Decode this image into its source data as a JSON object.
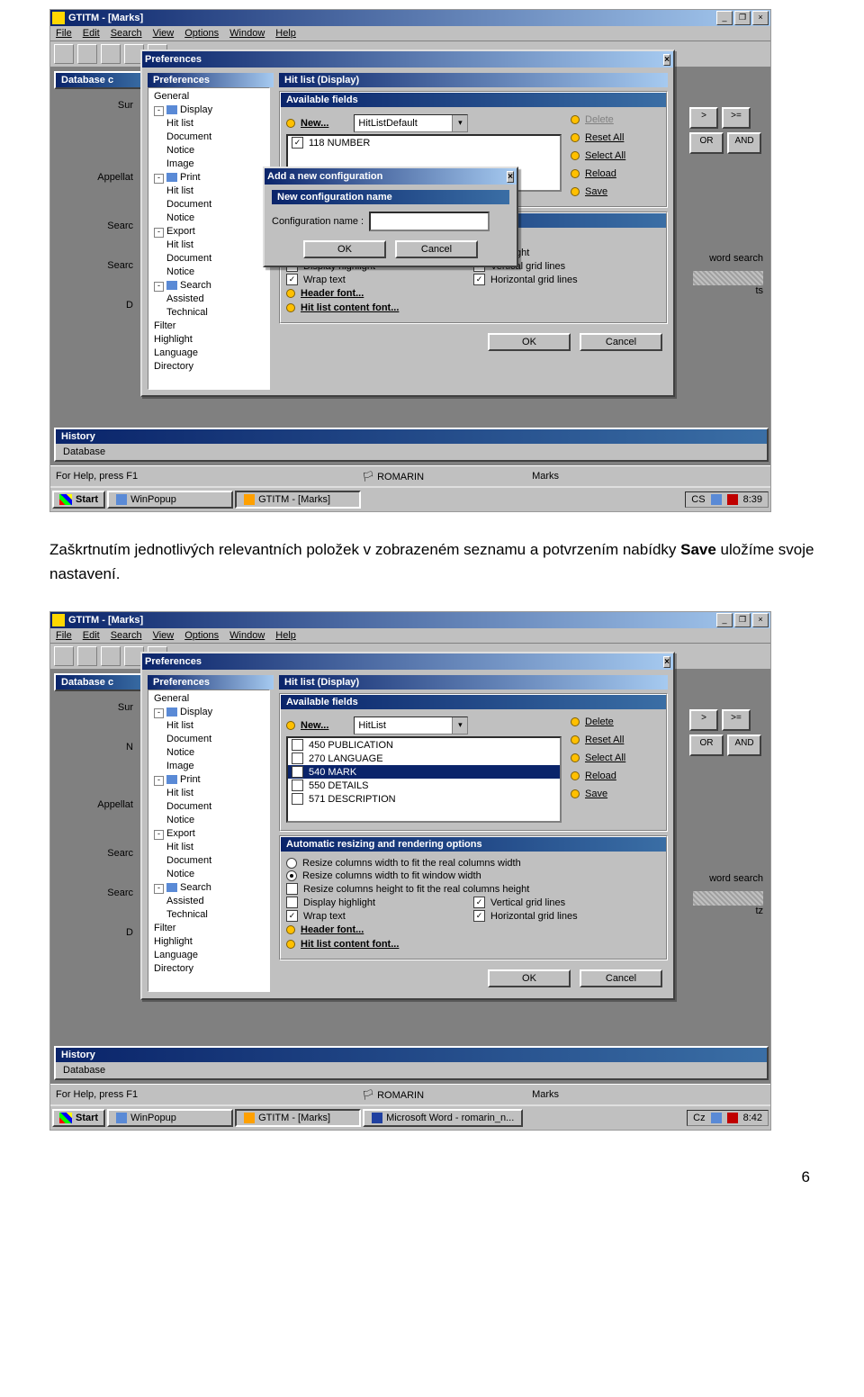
{
  "page_number": "6",
  "caption_before_bold": "Zaškrtnutím jednotlivých relevantních položek v zobrazeném seznamu a potvrzením nabídky ",
  "caption_bold": "Save",
  "caption_after_bold": " uložíme svoje nastavení.",
  "shot1": {
    "app_title": "GTITM - [Marks]",
    "menus": [
      "File",
      "Edit",
      "Search",
      "View",
      "Options",
      "Window",
      "Help"
    ],
    "side_labels": [
      "Sur",
      "Appellat",
      "Searc",
      "Searc",
      "D"
    ],
    "database_hdr": "Database c",
    "history_hdr": "History",
    "history_sub": "Database",
    "right_btns_row1": [
      ">",
      ">="
    ],
    "right_btns_row2": [
      "OR",
      "AND"
    ],
    "right_word": "word search",
    "right_word2": "ts",
    "prefs": {
      "title": "Preferences",
      "panel_title": "Preferences",
      "right_title": "Hit list (Display)",
      "tree": [
        {
          "lvl": 0,
          "t": "General"
        },
        {
          "lvl": 0,
          "t": "Display",
          "exp": "-",
          "icon": true
        },
        {
          "lvl": 1,
          "t": "Hit list"
        },
        {
          "lvl": 1,
          "t": "Document"
        },
        {
          "lvl": 1,
          "t": "Notice"
        },
        {
          "lvl": 1,
          "t": "Image"
        },
        {
          "lvl": 0,
          "t": "Print",
          "exp": "-",
          "icon": true
        },
        {
          "lvl": 1,
          "t": "Hit list"
        },
        {
          "lvl": 1,
          "t": "Document"
        },
        {
          "lvl": 1,
          "t": "Notice"
        },
        {
          "lvl": 0,
          "t": "Export",
          "exp": "-"
        },
        {
          "lvl": 1,
          "t": "Hit list"
        },
        {
          "lvl": 1,
          "t": "Document"
        },
        {
          "lvl": 1,
          "t": "Notice"
        },
        {
          "lvl": 0,
          "t": "Search",
          "exp": "-",
          "icon": true
        },
        {
          "lvl": 1,
          "t": "Assisted"
        },
        {
          "lvl": 1,
          "t": "Technical"
        },
        {
          "lvl": 0,
          "t": "Filter"
        },
        {
          "lvl": 0,
          "t": "Highlight"
        },
        {
          "lvl": 0,
          "t": "Language"
        },
        {
          "lvl": 0,
          "t": "Directory"
        }
      ],
      "avail_hdr": "Available fields",
      "new_lbl": "New...",
      "combo_value": "HitListDefault",
      "list_items": [
        {
          "chk": true,
          "t": "118 NUMBER"
        }
      ],
      "actions": [
        "Delete",
        "Reset All",
        "Select All",
        "Reload",
        "Save"
      ],
      "resize_hdr_partial": "tions",
      "resize_sub": "dth",
      "opt_rows_left": [
        {
          "chk": false,
          "t": "Resize columns height to fit the real columns height"
        },
        {
          "chk": false,
          "t": "Display highlight"
        },
        {
          "chk": true,
          "t": "Wrap text"
        }
      ],
      "opt_rows_right": [
        {
          "chk": true,
          "t": "Vertical grid lines"
        },
        {
          "chk": true,
          "t": "Horizontal grid lines"
        }
      ],
      "header_font": "Header font...",
      "content_font": "Hit list content font...",
      "ok": "OK",
      "cancel": "Cancel"
    },
    "modal": {
      "title": "Add a new configuration",
      "section": "New configuration name",
      "label": "Configuration name :",
      "ok": "OK",
      "cancel": "Cancel"
    },
    "status_left": "For Help, press F1",
    "status_mid1": "ROMARIN",
    "status_mid2": "Marks",
    "taskbar": {
      "start": "Start",
      "tasks": [
        "WinPopup",
        "GTITM - [Marks]"
      ],
      "tray_lang": "CS",
      "time": "8:39"
    }
  },
  "shot2": {
    "app_title": "GTITM - [Marks]",
    "menus": [
      "File",
      "Edit",
      "Search",
      "View",
      "Options",
      "Window",
      "Help"
    ],
    "side_labels": [
      "Sur",
      "N",
      "Appellat",
      "Searc",
      "Searc",
      "D"
    ],
    "database_hdr": "Database c",
    "history_hdr": "History",
    "history_sub": "Database",
    "right_btns_row1": [
      ">",
      ">="
    ],
    "right_btns_row2": [
      "OR",
      "AND"
    ],
    "right_word": "word search",
    "right_word2": "tz",
    "prefs": {
      "title": "Preferences",
      "panel_title": "Preferences",
      "right_title": "Hit list (Display)",
      "tree": [
        {
          "lvl": 0,
          "t": "General"
        },
        {
          "lvl": 0,
          "t": "Display",
          "exp": "-",
          "icon": true
        },
        {
          "lvl": 1,
          "t": "Hit list"
        },
        {
          "lvl": 1,
          "t": "Document"
        },
        {
          "lvl": 1,
          "t": "Notice"
        },
        {
          "lvl": 1,
          "t": "Image"
        },
        {
          "lvl": 0,
          "t": "Print",
          "exp": "-",
          "icon": true
        },
        {
          "lvl": 1,
          "t": "Hit list"
        },
        {
          "lvl": 1,
          "t": "Document"
        },
        {
          "lvl": 1,
          "t": "Notice"
        },
        {
          "lvl": 0,
          "t": "Export",
          "exp": "-"
        },
        {
          "lvl": 1,
          "t": "Hit list"
        },
        {
          "lvl": 1,
          "t": "Document"
        },
        {
          "lvl": 1,
          "t": "Notice"
        },
        {
          "lvl": 0,
          "t": "Search",
          "exp": "-",
          "icon": true
        },
        {
          "lvl": 1,
          "t": "Assisted"
        },
        {
          "lvl": 1,
          "t": "Technical"
        },
        {
          "lvl": 0,
          "t": "Filter"
        },
        {
          "lvl": 0,
          "t": "Highlight"
        },
        {
          "lvl": 0,
          "t": "Language"
        },
        {
          "lvl": 0,
          "t": "Directory"
        }
      ],
      "avail_hdr": "Available fields",
      "new_lbl": "New...",
      "combo_value": "HitList",
      "list_items": [
        {
          "chk": false,
          "t": "450 PUBLICATION"
        },
        {
          "chk": false,
          "t": "270 LANGUAGE"
        },
        {
          "chk": true,
          "t": "540 MARK",
          "sel": true
        },
        {
          "chk": false,
          "t": "550 DETAILS"
        },
        {
          "chk": false,
          "t": "571 DESCRIPTION"
        }
      ],
      "actions": [
        "Delete",
        "Reset All",
        "Select All",
        "Reload",
        "Save"
      ],
      "resize_hdr": "Automatic resizing and rendering options",
      "opt_radios": [
        {
          "on": false,
          "t": "Resize columns width to fit the real columns width"
        },
        {
          "on": true,
          "t": "Resize columns width to fit window width"
        }
      ],
      "opt_rows_left": [
        {
          "chk": false,
          "t": "Resize columns height to fit the real columns height"
        },
        {
          "chk": false,
          "t": "Display highlight"
        },
        {
          "chk": true,
          "t": "Wrap text"
        }
      ],
      "opt_rows_right": [
        {
          "chk": true,
          "t": "Vertical grid lines"
        },
        {
          "chk": true,
          "t": "Horizontal grid lines"
        }
      ],
      "header_font": "Header font...",
      "content_font": "Hit list content font...",
      "ok": "OK",
      "cancel": "Cancel"
    },
    "status_left": "For Help, press F1",
    "status_mid1": "ROMARIN",
    "status_mid2": "Marks",
    "taskbar": {
      "start": "Start",
      "tasks": [
        "WinPopup",
        "GTITM - [Marks]",
        "Microsoft Word - romarin_n..."
      ],
      "tray_lang": "Cz",
      "time": "8:42"
    }
  }
}
